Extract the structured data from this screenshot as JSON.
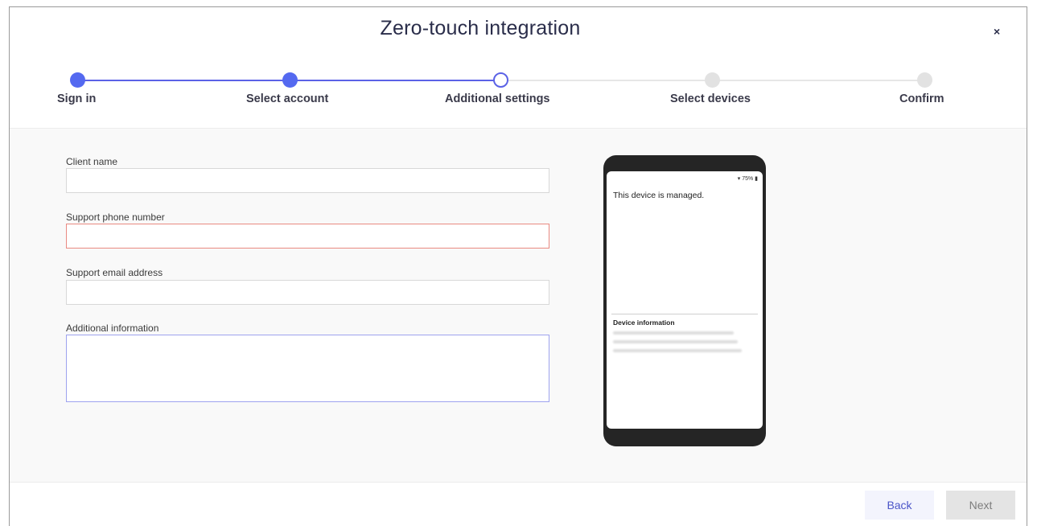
{
  "dialog": {
    "title": "Zero-touch integration",
    "close_label": "×"
  },
  "stepper": {
    "steps": [
      {
        "label": "Sign in",
        "state": "done"
      },
      {
        "label": "Select account",
        "state": "done"
      },
      {
        "label": "Additional settings",
        "state": "current"
      },
      {
        "label": "Select devices",
        "state": "todo"
      },
      {
        "label": "Confirm",
        "state": "todo"
      }
    ]
  },
  "form": {
    "client_name": {
      "label": "Client name",
      "value": ""
    },
    "support_phone": {
      "label": "Support phone number",
      "value": "",
      "state": "error"
    },
    "support_email": {
      "label": "Support email address",
      "value": ""
    },
    "additional_info": {
      "label": "Additional information",
      "value": "",
      "state": "focused"
    }
  },
  "preview": {
    "status_text": "▾ 75% ▮",
    "managed_text": "This device is managed.",
    "device_info_heading": "Device information"
  },
  "footer": {
    "back_label": "Back",
    "next_label": "Next"
  },
  "colors": {
    "accent": "#5469f0",
    "error": "#e98a82",
    "step_todo": "#e2e2e2"
  }
}
